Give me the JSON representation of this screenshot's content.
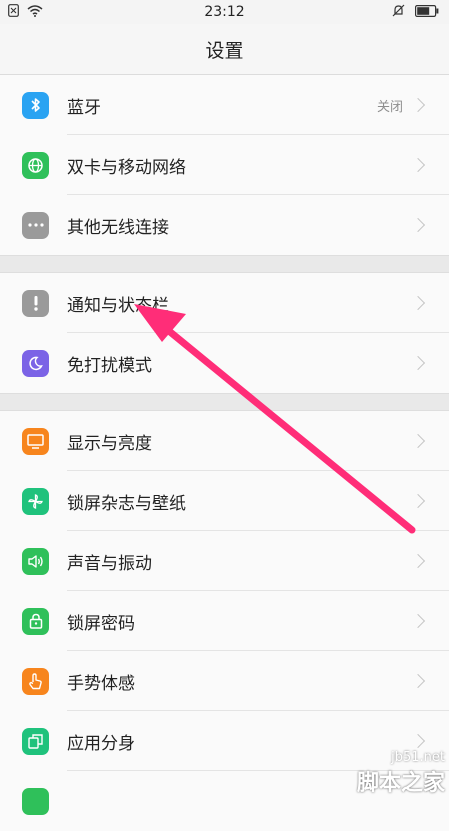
{
  "status_bar": {
    "time": "23:12",
    "icons": [
      "sim-off-icon",
      "wifi-icon",
      "silent-bell-icon",
      "battery-icon"
    ]
  },
  "header": {
    "title": "设置"
  },
  "groups": [
    {
      "items": [
        {
          "label": "蓝牙",
          "value": "关闭",
          "icon": "bluetooth-icon",
          "color": "#2aa3f2"
        },
        {
          "label": "双卡与移动网络",
          "icon": "globe-icon",
          "color": "#2fc05a"
        },
        {
          "label": "其他无线连接",
          "icon": "more-icon",
          "color": "#9a9a9a"
        }
      ]
    },
    {
      "items": [
        {
          "label": "通知与状态栏",
          "icon": "notification-icon",
          "color": "#9a9a9a"
        },
        {
          "label": "免打扰模式",
          "icon": "moon-icon",
          "color": "#7b63e6"
        }
      ]
    },
    {
      "items": [
        {
          "label": "显示与亮度",
          "icon": "display-icon",
          "color": "#f7851d"
        },
        {
          "label": "锁屏杂志与壁纸",
          "icon": "pinwheel-icon",
          "color": "#1fc27c"
        },
        {
          "label": "声音与振动",
          "icon": "speaker-icon",
          "color": "#2fc05a"
        },
        {
          "label": "锁屏密码",
          "icon": "lock-icon",
          "color": "#2fc05a"
        },
        {
          "label": "手势体感",
          "icon": "gesture-icon",
          "color": "#f7851d"
        },
        {
          "label": "应用分身",
          "icon": "clone-icon",
          "color": "#1fc27c"
        }
      ]
    }
  ],
  "watermark": {
    "site": "jb51.net",
    "brand": "脚本之家"
  },
  "annotation": {
    "arrow_color": "#ff2d78"
  }
}
